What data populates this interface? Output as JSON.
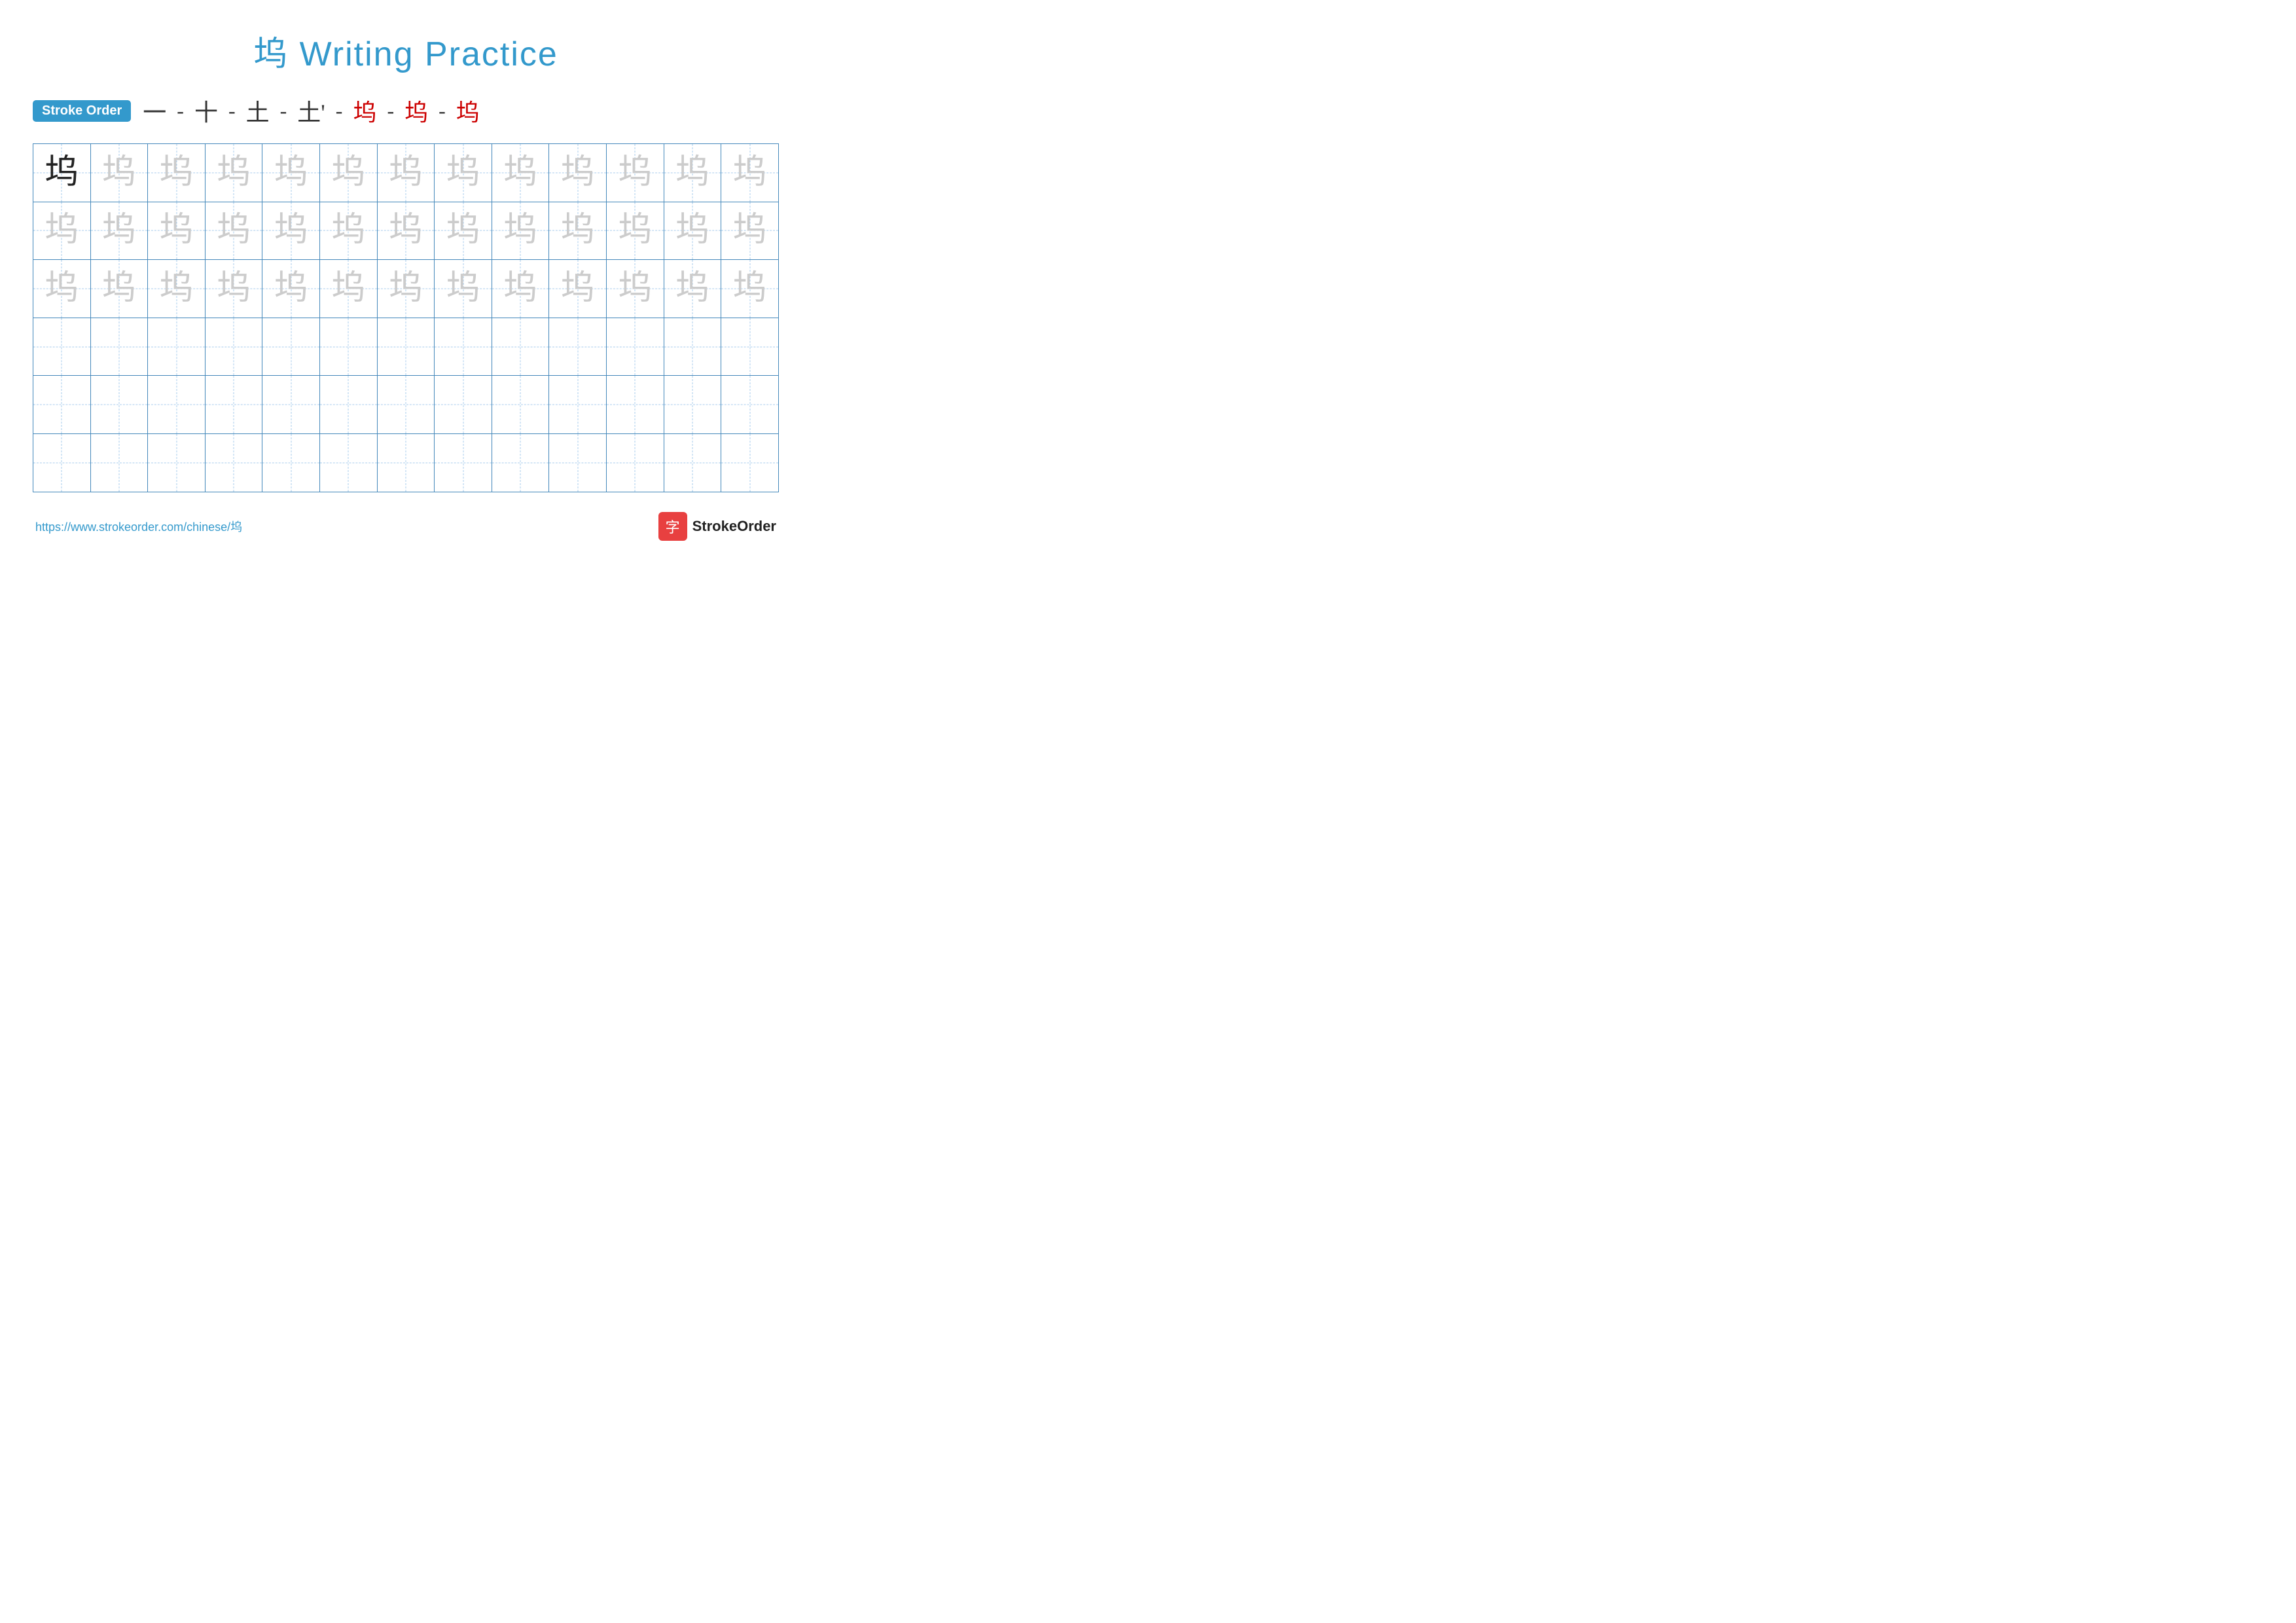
{
  "title": {
    "text": "坞 Writing Practice",
    "color": "#3399cc"
  },
  "stroke_order": {
    "badge_label": "Stroke Order",
    "sequence": [
      "一",
      "十",
      "土",
      "土'",
      "坞",
      "坞",
      "坞"
    ],
    "red_indices": [
      4,
      5,
      6
    ]
  },
  "grid": {
    "rows": 6,
    "cols": 13,
    "character": "坞",
    "row_types": [
      "dark_then_light",
      "light",
      "light",
      "empty",
      "empty",
      "empty"
    ]
  },
  "footer": {
    "url": "https://www.strokeorder.com/chinese/坞",
    "logo_char": "字",
    "logo_text": "StrokeOrder"
  }
}
